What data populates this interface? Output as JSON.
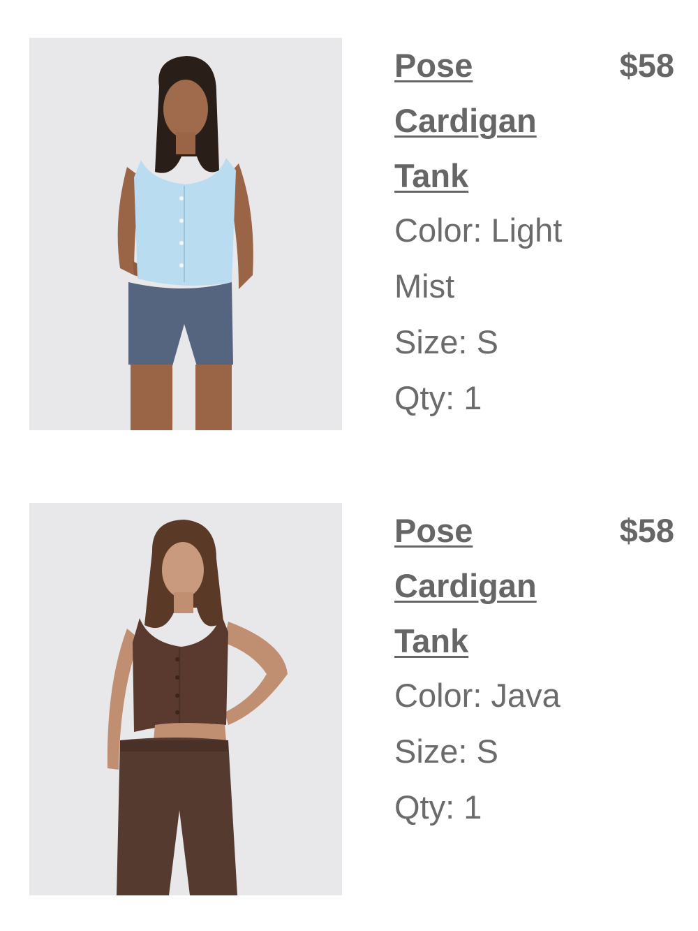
{
  "cart_items": [
    {
      "name": "Pose Cardigan Tank",
      "price": "$58",
      "color_label": "Color:",
      "color_value": "Light Mist",
      "size_label": "Size:",
      "size_value": "S",
      "qty_label": "Qty:",
      "qty_value": "1",
      "image_description": "model-wearing-light-blue-cardigan-tank"
    },
    {
      "name": "Pose Cardigan Tank",
      "price": "$58",
      "color_label": "Color:",
      "color_value": "Java",
      "size_label": "Size:",
      "size_value": "S",
      "qty_label": "Qty:",
      "qty_value": "1",
      "image_description": "model-wearing-brown-cardigan-tank"
    }
  ],
  "colors": {
    "light_mist": "#b9dcf0",
    "java": "#5a3a2e",
    "text": "#6b6b6b"
  }
}
